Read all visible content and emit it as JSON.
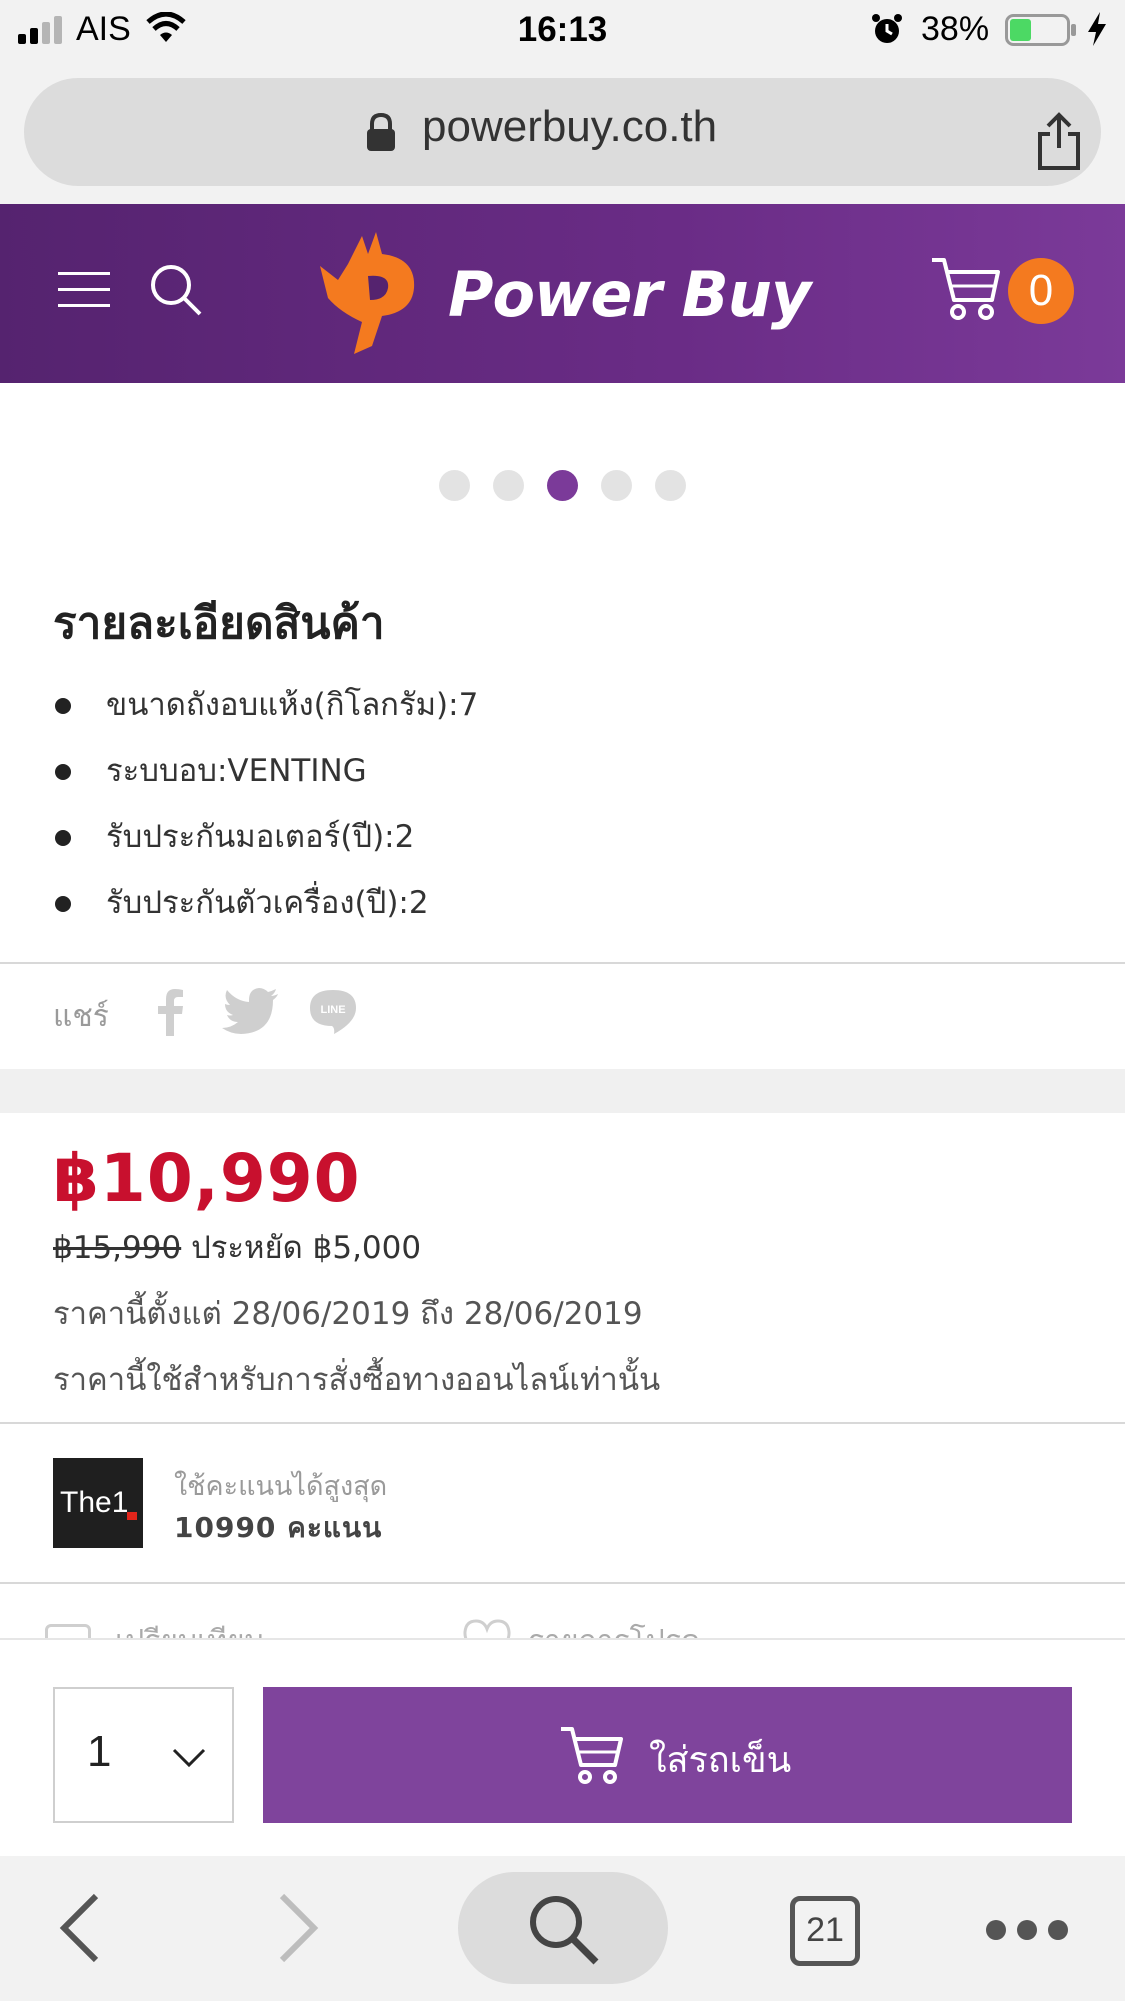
{
  "status_bar": {
    "carrier": "AIS",
    "time": "16:13",
    "battery_percent": "38%",
    "battery_level": 0.38,
    "icons": [
      "signal-icon",
      "wifi-icon",
      "alarm-icon",
      "battery-icon",
      "charging-icon"
    ]
  },
  "browser": {
    "url": "powerbuy.co.th",
    "tab_count": "21",
    "icons": [
      "lock-icon",
      "share-icon",
      "back-icon",
      "forward-icon",
      "search-icon",
      "tabs-icon",
      "more-icon"
    ]
  },
  "header": {
    "brand": "Power Buy",
    "cart_count": "0",
    "icons": [
      "menu-icon",
      "search-icon",
      "cart-icon"
    ],
    "colors": {
      "header_start": "#55236f",
      "header_end": "#7b3a99",
      "accent_orange": "#f47a1f"
    }
  },
  "carousel": {
    "total": 5,
    "active_index": 2
  },
  "details": {
    "title": "รายละเอียดสินค้า",
    "specs": [
      "ขนาดถังอบแห้ง(กิโลกรัม):7",
      "ระบบอบ:VENTING",
      "รับประกันมอเตอร์(ปี):2",
      "รับประกันตัวเครื่อง(ปี):2"
    ]
  },
  "share": {
    "label": "แชร์",
    "icons": [
      "facebook-icon",
      "twitter-icon",
      "line-icon"
    ]
  },
  "pricing": {
    "price": "฿10,990",
    "old_price": "฿15,990",
    "savings": "ประหยัด ฿5,000",
    "period": "ราคานี้ตั้งแต่ 28/06/2019 ถึง 28/06/2019",
    "note": "ราคานี้ใช้สำหรับการสั่งซื้อทางออนไลน์เท่านั้น",
    "price_color": "#c8102e"
  },
  "the1": {
    "logo_text": "The1",
    "label": "ใช้คะแนนได้สูงสุด",
    "points": "10990 คะแนน"
  },
  "partial_row": {
    "compare": "เปรียบเทียบ",
    "wishlist": "รายการโปรด"
  },
  "cart_bar": {
    "quantity": "1",
    "add_label": "ใส่รถเข็น",
    "button_color": "#7f449c"
  }
}
